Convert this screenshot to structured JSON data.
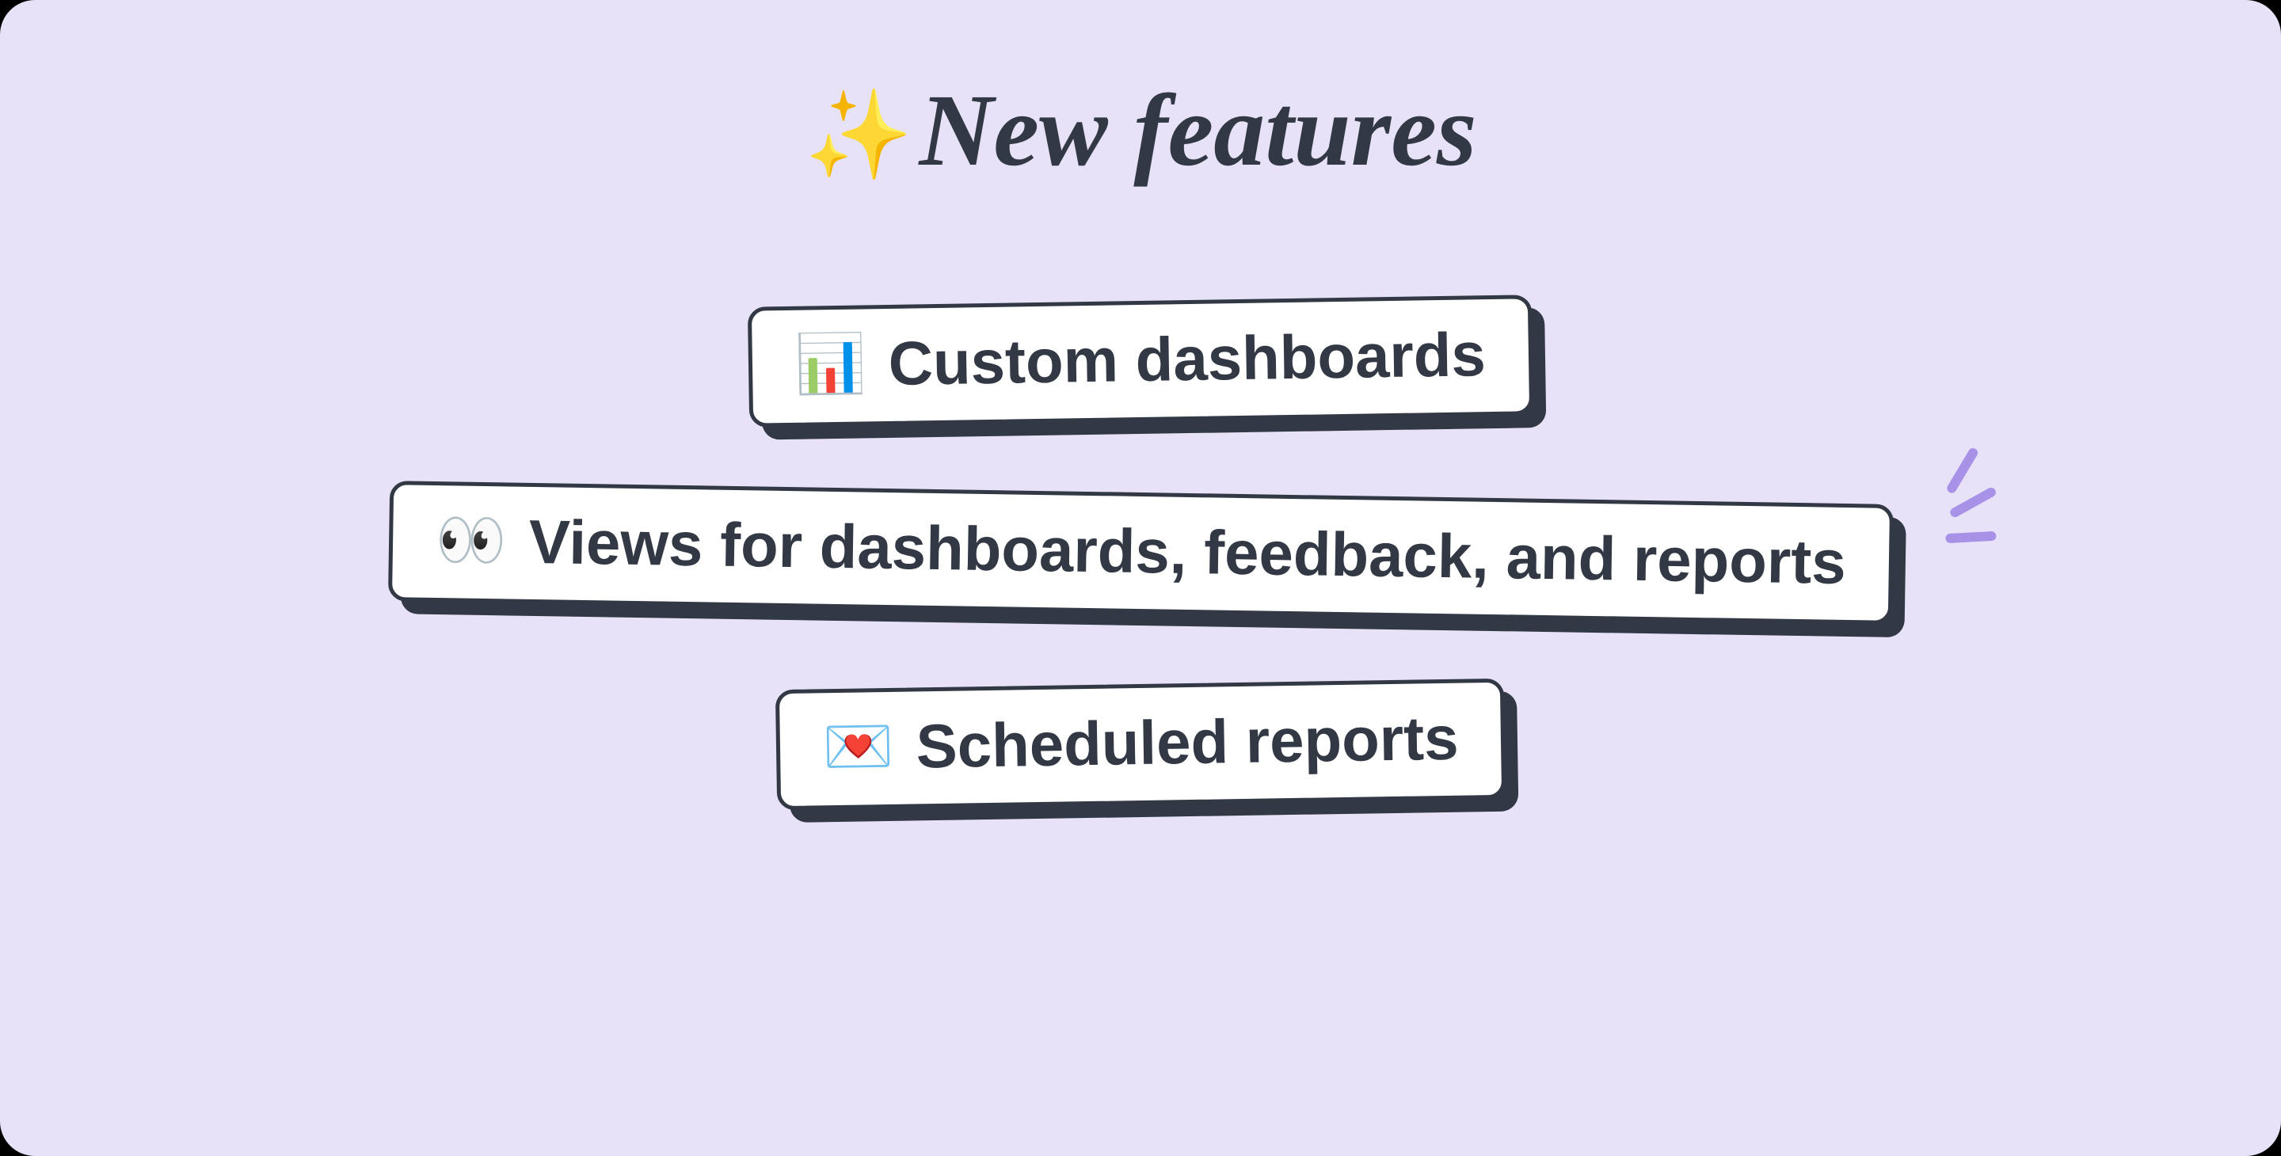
{
  "heading": {
    "emoji": "✨",
    "title": "New features"
  },
  "cards": {
    "0": {
      "emoji": "📊",
      "label": "Custom dashboards"
    },
    "1": {
      "emoji": "👀",
      "label": "Views for dashboards, feedback, and reports"
    },
    "2": {
      "emoji": "💌",
      "label": "Scheduled reports"
    }
  },
  "colors": {
    "bg": "#E8E2F8",
    "text": "#333845",
    "accent": "#A892E8",
    "card": "#FFFFFF"
  }
}
